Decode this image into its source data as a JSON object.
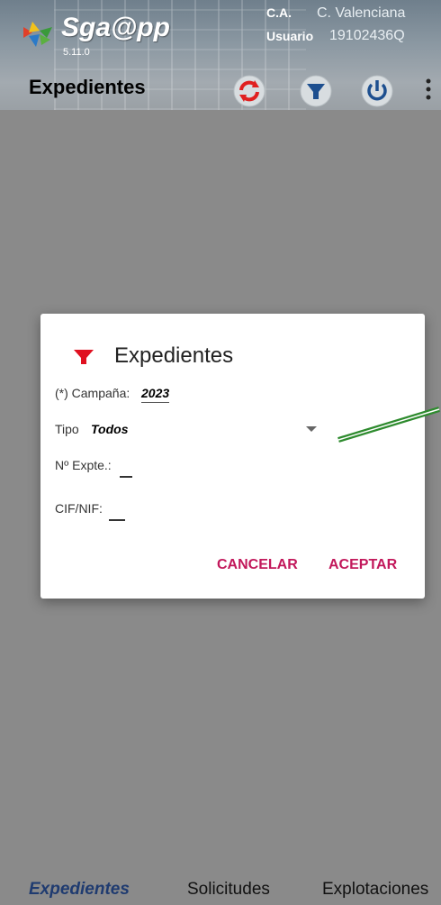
{
  "app": {
    "name": "Sga@pp",
    "version": "5.11.0",
    "ca_label": "C.A.",
    "ca_value": "C. Valenciana",
    "user_label": "Usuario",
    "user_value": "19102436Q"
  },
  "toolbar": {
    "title": "Expedientes",
    "icons": [
      "refresh-icon",
      "filter-icon",
      "power-icon",
      "more-icon"
    ]
  },
  "dialog": {
    "title": "Expedientes",
    "campana_label": "(*) Campaña:",
    "campana_value": "2023",
    "tipo_label": "Tipo",
    "tipo_value": "Todos",
    "expte_label": "Nº Expte.:",
    "nif_label": "CIF/NIF:",
    "cancel": "CANCELAR",
    "accept": "ACEPTAR"
  },
  "bottom_nav": {
    "items": [
      "Expedientes",
      "Solicitudes",
      "Explotaciones"
    ],
    "active": "Expedientes"
  },
  "colors": {
    "accent": "#c2185b",
    "filter_icon": "#e01020",
    "annotation_arrow": "#2e8b2e"
  }
}
